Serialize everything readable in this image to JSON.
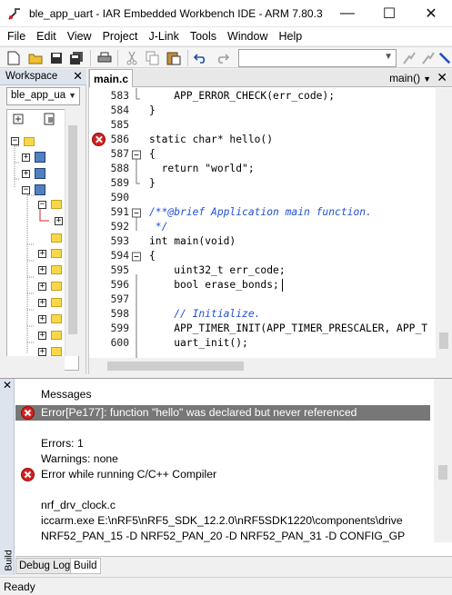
{
  "window": {
    "title": "ble_app_uart - IAR Embedded Workbench IDE - ARM 7.80.3",
    "minimize": "—",
    "maximize": "☐",
    "close": "✕"
  },
  "menu": [
    "File",
    "Edit",
    "View",
    "Project",
    "J-Link",
    "Tools",
    "Window",
    "Help"
  ],
  "toolbar": {
    "search_value": "",
    "icons": [
      "new-file",
      "open",
      "save",
      "save-all",
      "print",
      "cut",
      "copy",
      "paste",
      "undo",
      "redo"
    ]
  },
  "workspace": {
    "title": "Workspace",
    "close": "✕",
    "project": "ble_app_ua"
  },
  "editor": {
    "tab": "main.c",
    "function": "main()",
    "close": "✕",
    "lines": [
      {
        "n": "583",
        "code": "    APP_ERROR_CHECK(err_code);",
        "type": "plain"
      },
      {
        "n": "584",
        "code": "}",
        "type": "plain"
      },
      {
        "n": "585",
        "code": "",
        "type": "plain"
      },
      {
        "n": "586",
        "code": "static char* hello()",
        "type": "error"
      },
      {
        "n": "587",
        "code": "{",
        "type": "plain"
      },
      {
        "n": "588",
        "code": "  return \"world\";",
        "type": "plain"
      },
      {
        "n": "589",
        "code": "}",
        "type": "plain"
      },
      {
        "n": "590",
        "code": "",
        "type": "plain"
      },
      {
        "n": "591",
        "code": "/**@brief Application main function.",
        "type": "comment"
      },
      {
        "n": "592",
        "code": " */",
        "type": "comment"
      },
      {
        "n": "593",
        "code": "int main(void)",
        "type": "plain"
      },
      {
        "n": "594",
        "code": "{",
        "type": "plain"
      },
      {
        "n": "595",
        "code": "    uint32_t err_code;",
        "type": "plain"
      },
      {
        "n": "596",
        "code": "    bool erase_bonds;",
        "type": "plain"
      },
      {
        "n": "597",
        "code": "",
        "type": "plain"
      },
      {
        "n": "598",
        "code": "    // Initialize.",
        "type": "comment"
      },
      {
        "n": "599",
        "code": "    APP_TIMER_INIT(APP_TIMER_PRESCALER, APP_T",
        "type": "plain"
      },
      {
        "n": "600",
        "code": "    uart_init();",
        "type": "plain"
      }
    ]
  },
  "messages": {
    "header": "Messages",
    "error_selected": "Error[Pe177]: function \"hello\" was declared but never referenced",
    "errors": "Errors: 1",
    "warnings": "Warnings: none",
    "compiler_error": "Error while running C/C++ Compiler",
    "file": "nrf_drv_clock.c",
    "cmd1": "iccarm.exe E:\\nRF5\\nRF5_SDK_12.2.0\\nRF5SDK1220\\components\\drive",
    "cmd2": "NRF52_PAN_15 -D NRF52_PAN_20 -D NRF52_PAN_31 -D CONFIG_GP"
  },
  "bottom_tabs": [
    "Debug Log",
    "Build"
  ],
  "panel_side_label": "Build",
  "status": "Ready"
}
